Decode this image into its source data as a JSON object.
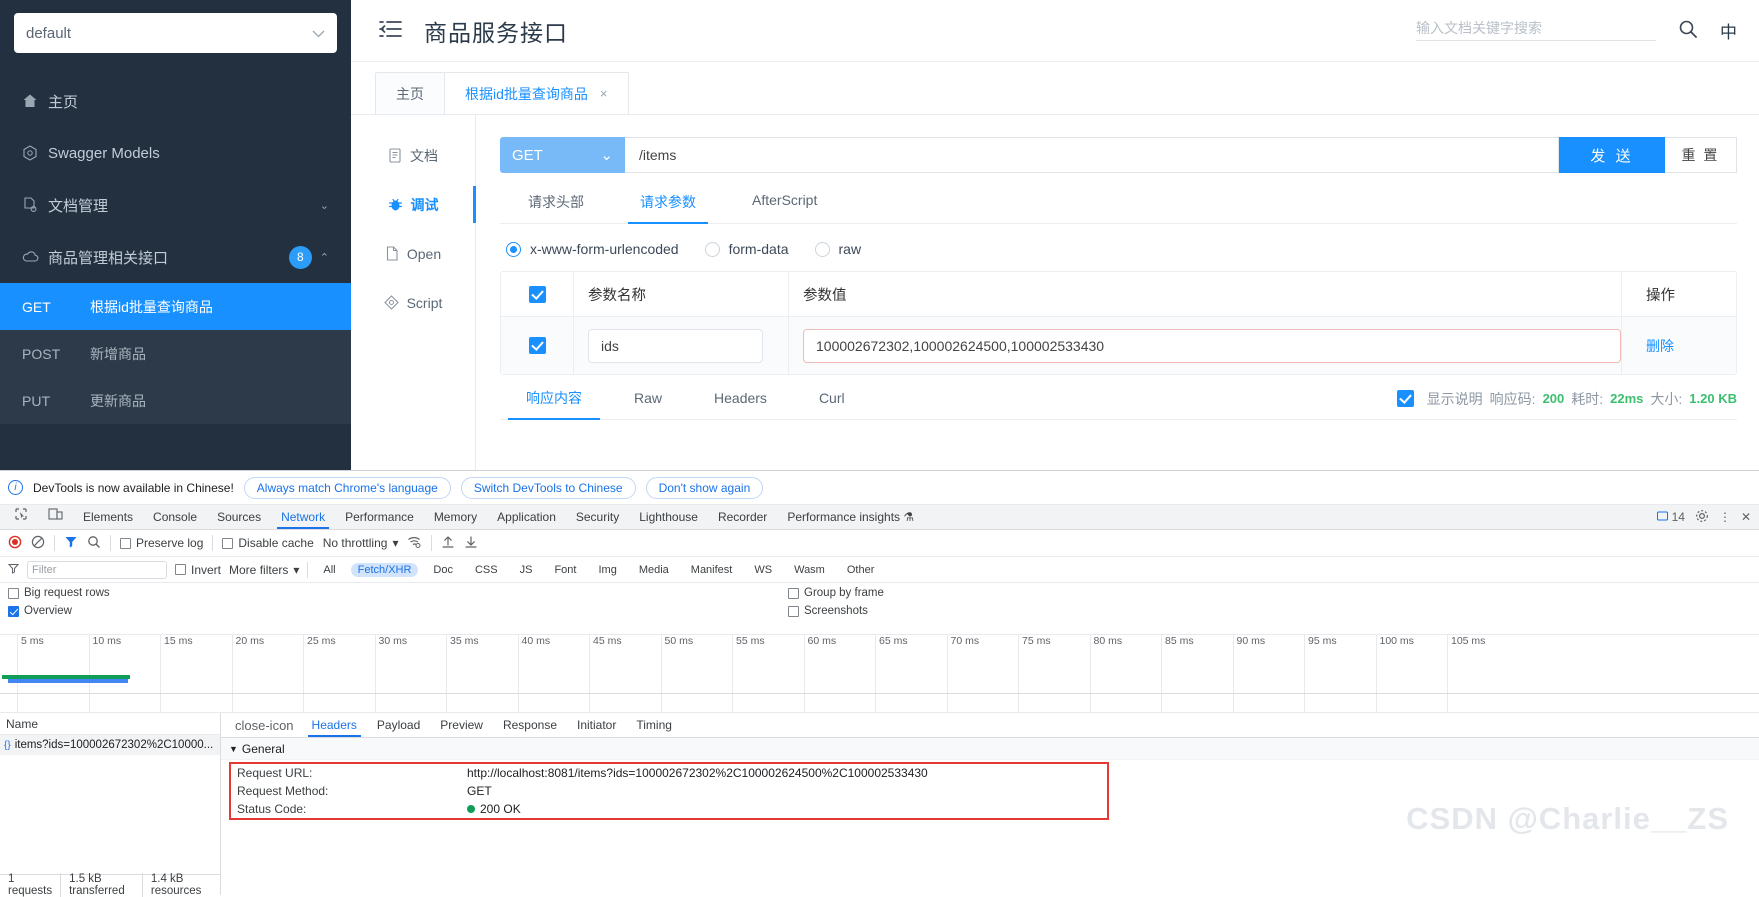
{
  "app": {
    "project_select": {
      "value": "default",
      "icon": "chevron-down-icon"
    },
    "sidebar_nav": [
      {
        "label": "主页",
        "icon": "home-icon"
      },
      {
        "label": "Swagger Models",
        "icon": "cube-icon"
      },
      {
        "label": "文档管理",
        "icon": "doc-gear-icon",
        "chevron": "⌄"
      },
      {
        "label": "商品管理相关接口",
        "icon": "cloud-api-icon",
        "badge": "8",
        "chevron": "⌃"
      }
    ],
    "api_items": [
      {
        "method": "GET",
        "label": "根据id批量查询商品",
        "active": true
      },
      {
        "method": "POST",
        "label": "新增商品",
        "active": false
      },
      {
        "method": "PUT",
        "label": "更新商品",
        "active": false
      }
    ],
    "header": {
      "collapse_icon": "collapse-menu-icon",
      "title": "商品服务接口",
      "search_placeholder": "输入文档关键字搜索",
      "search_value": "",
      "search_icon": "search-icon",
      "lang_label": "中"
    },
    "tabs": [
      {
        "label": "主页",
        "closable": false,
        "active": false
      },
      {
        "label": "根据id批量查询商品",
        "closable": true,
        "close_label": "×",
        "active": true
      }
    ],
    "left_rail": [
      {
        "label": "文档",
        "icon": "document-icon",
        "active": false
      },
      {
        "label": "调试",
        "icon": "bug-icon",
        "active": true
      },
      {
        "label": "Open",
        "icon": "file-icon",
        "active": false
      },
      {
        "label": "Script",
        "icon": "script-icon",
        "active": false
      }
    ],
    "request": {
      "method": "GET",
      "method_chevron": "⌄",
      "url": "/items",
      "send_label": "发 送",
      "reset_label": "重 置",
      "subtabs": [
        {
          "label": "请求头部",
          "active": false
        },
        {
          "label": "请求参数",
          "active": true
        },
        {
          "label": "AfterScript",
          "active": false
        }
      ],
      "body_types": [
        {
          "label": "x-www-form-urlencoded",
          "selected": true
        },
        {
          "label": "form-data",
          "selected": false
        },
        {
          "label": "raw",
          "selected": false
        }
      ],
      "param_table": {
        "headers": [
          "参数名称",
          "参数值",
          "操作"
        ],
        "rows": [
          {
            "checked": true,
            "name": "ids",
            "value": "100002672302,100002624500,100002533430",
            "action": "删除"
          }
        ]
      }
    },
    "response": {
      "tabs": [
        {
          "label": "响应内容",
          "active": true
        },
        {
          "label": "Raw",
          "active": false
        },
        {
          "label": "Headers",
          "active": false
        },
        {
          "label": "Curl",
          "active": false
        }
      ],
      "show_desc_label": "显示说明",
      "show_desc_checked": true,
      "status_label": "响应码:",
      "status_value": "200",
      "time_label": "耗时:",
      "time_value": "22ms",
      "size_label": "大小:",
      "size_value": "1.20 KB"
    }
  },
  "devtools": {
    "notice": {
      "icon": "info-icon",
      "text": "DevTools is now available in Chinese!",
      "buttons": [
        "Always match Chrome's language",
        "Switch DevTools to Chinese",
        "Don't show again"
      ]
    },
    "panel_tabs": [
      {
        "label": "Elements",
        "active": false
      },
      {
        "label": "Console",
        "active": false
      },
      {
        "label": "Sources",
        "active": false
      },
      {
        "label": "Network",
        "active": true
      },
      {
        "label": "Performance",
        "active": false
      },
      {
        "label": "Memory",
        "active": false
      },
      {
        "label": "Application",
        "active": false
      },
      {
        "label": "Security",
        "active": false
      },
      {
        "label": "Lighthouse",
        "active": false
      },
      {
        "label": "Recorder",
        "active": false
      },
      {
        "label": "Performance insights ⚗",
        "active": false
      }
    ],
    "tabs_right": {
      "error_count": "14",
      "settings_icon": "gear-icon",
      "more_icon": "kebab-icon",
      "close_icon": "close-icon"
    },
    "toolbar": {
      "record_icon": "record-icon",
      "clear_icon": "clear-icon",
      "filter_icon": "filter-icon",
      "search_icon": "search-icon",
      "preserve_log": {
        "label": "Preserve log",
        "checked": false
      },
      "disable_cache": {
        "label": "Disable cache",
        "checked": false
      },
      "throttling": "No throttling",
      "throttling_chevron": "▾",
      "wifi_icon": "wifi-settings-icon",
      "import_icon": "import-har-icon",
      "export_icon": "export-har-icon"
    },
    "filterbar": {
      "filter_placeholder": "Filter",
      "filter_icon": "filter-funnel-icon",
      "invert": {
        "label": "Invert",
        "checked": false
      },
      "more_filters": "More filters",
      "more_filters_chevron": "▾",
      "types": [
        "All",
        "Fetch/XHR",
        "Doc",
        "CSS",
        "JS",
        "Font",
        "Img",
        "Media",
        "Manifest",
        "WS",
        "Wasm",
        "Other"
      ],
      "active_types": [
        "Fetch/XHR"
      ]
    },
    "options": {
      "big_request_rows": {
        "label": "Big request rows",
        "checked": false
      },
      "overview": {
        "label": "Overview",
        "checked": true
      },
      "group_by_frame": {
        "label": "Group by frame",
        "checked": false
      },
      "screenshots": {
        "label": "Screenshots",
        "checked": false
      }
    },
    "timeline_ticks": [
      "5 ms",
      "10 ms",
      "15 ms",
      "20 ms",
      "25 ms",
      "30 ms",
      "35 ms",
      "40 ms",
      "45 ms",
      "50 ms",
      "55 ms",
      "60 ms",
      "65 ms",
      "70 ms",
      "75 ms",
      "80 ms",
      "85 ms",
      "90 ms",
      "95 ms",
      "100 ms",
      "105 ms"
    ],
    "request_list": {
      "column_header": "Name",
      "rows": [
        {
          "name": "items?ids=100002672302%2C10000...",
          "icon": "xhr-icon"
        }
      ],
      "footer": [
        "1 requests",
        "1.5 kB transferred",
        "1.4 kB resources"
      ]
    },
    "detail": {
      "close_icon": "close-icon",
      "tabs": [
        {
          "label": "Headers",
          "active": true
        },
        {
          "label": "Payload",
          "active": false
        },
        {
          "label": "Preview",
          "active": false
        },
        {
          "label": "Response",
          "active": false
        },
        {
          "label": "Initiator",
          "active": false
        },
        {
          "label": "Timing",
          "active": false
        }
      ],
      "section_title": "General",
      "section_caret": "▼",
      "general": [
        {
          "key": "Request URL:",
          "value": "http://localhost:8081/items?ids=100002672302%2C100002624500%2C100002533430"
        },
        {
          "key": "Request Method:",
          "value": "GET"
        },
        {
          "key": "Status Code:",
          "value": "200 OK",
          "dot": true
        }
      ]
    }
  },
  "watermark": "CSDN @Charlie__ZS"
}
